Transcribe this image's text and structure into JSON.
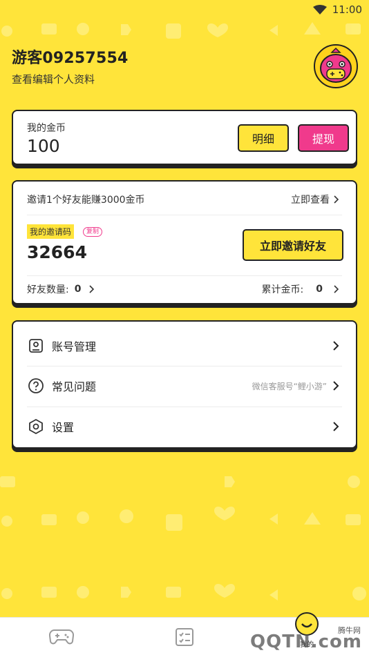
{
  "status_bar": {
    "time": "11:00"
  },
  "profile": {
    "username": "游客09257554",
    "edit_link": "查看编辑个人资料"
  },
  "coins": {
    "label": "我的金币",
    "value": "100",
    "detail_button": "明细",
    "withdraw_button": "提现"
  },
  "invite": {
    "headline": "邀请1个好友能赚3000金币",
    "view_link": "立即查看",
    "code_label": "我的邀请码",
    "copy_label": "复制",
    "code": "32664",
    "invite_button": "立即邀请好友",
    "friends_label": "好友数量:",
    "friends_count": "0",
    "total_label": "累计金币:",
    "total_count": "0"
  },
  "menu": {
    "items": [
      {
        "label": "账号管理",
        "icon": "account-icon",
        "note": ""
      },
      {
        "label": "常见问题",
        "icon": "question-icon",
        "note": "微信客服号“鲤小游”"
      },
      {
        "label": "设置",
        "icon": "settings-icon",
        "note": ""
      }
    ]
  },
  "bottom_nav": {
    "items": [
      {
        "icon": "gamepad-icon"
      },
      {
        "icon": "tasks-icon"
      },
      {
        "icon": "profile-icon",
        "label": "我的"
      }
    ]
  },
  "watermark": {
    "text": "QQTN.com",
    "small": "腾牛网"
  },
  "colors": {
    "background": "#FFE43A",
    "accent_pink": "#F03A8C",
    "border": "#222222"
  }
}
